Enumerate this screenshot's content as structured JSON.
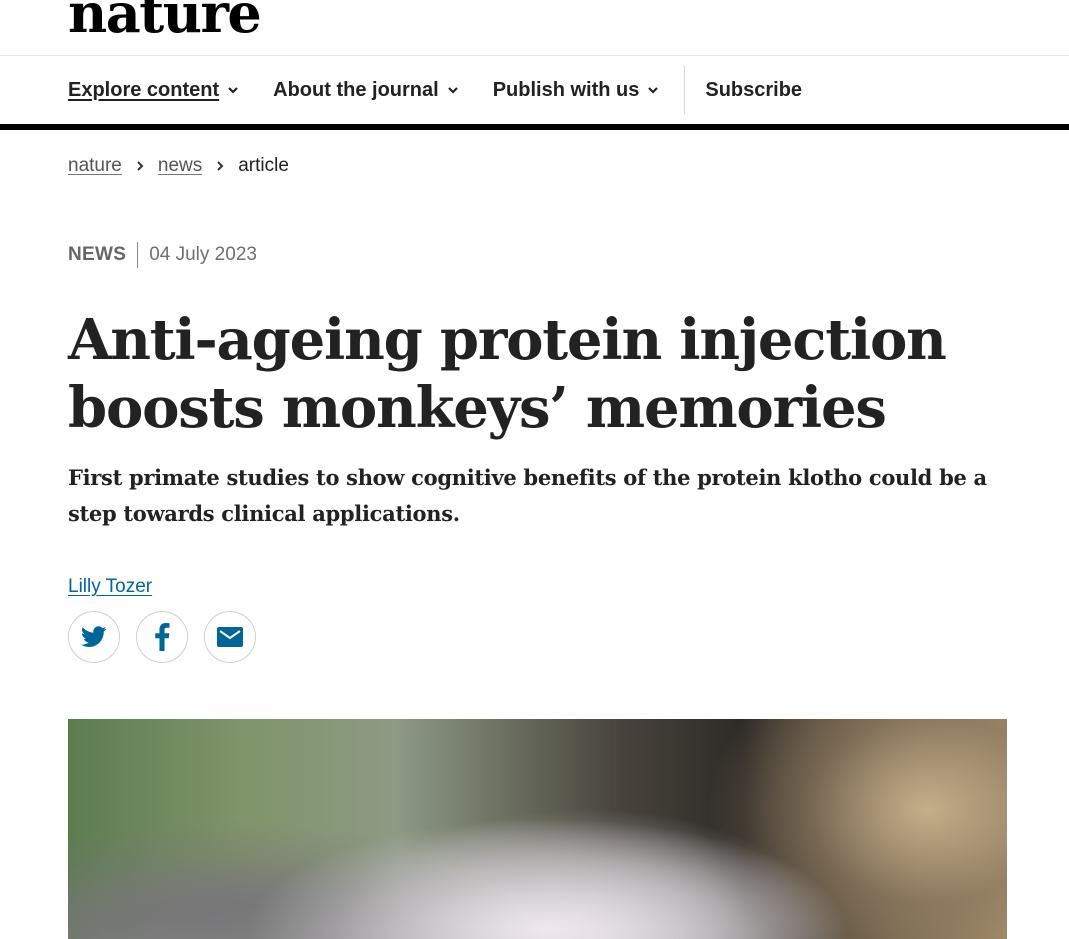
{
  "site": {
    "logo": "nature"
  },
  "nav": {
    "items": [
      {
        "label": "Explore content",
        "active": true
      },
      {
        "label": "About the journal",
        "active": false
      },
      {
        "label": "Publish with us",
        "active": false
      }
    ],
    "subscribe": "Subscribe"
  },
  "breadcrumb": {
    "items": [
      "nature",
      "news"
    ],
    "current": "article"
  },
  "article": {
    "type": "NEWS",
    "date": "04 July 2023",
    "title": "Anti-ageing protein injection boosts monkeys’ memories",
    "standfirst": "First primate studies to show cognitive benefits of the protein klotho could be a step towards clinical applications.",
    "author": "Lilly Tozer"
  },
  "share": {
    "icons": [
      "twitter-icon",
      "facebook-icon",
      "email-icon"
    ],
    "icon_color": "#006699"
  },
  "colors": {
    "link": "#006699",
    "text": "#222222",
    "nav_rule": "#000000"
  }
}
